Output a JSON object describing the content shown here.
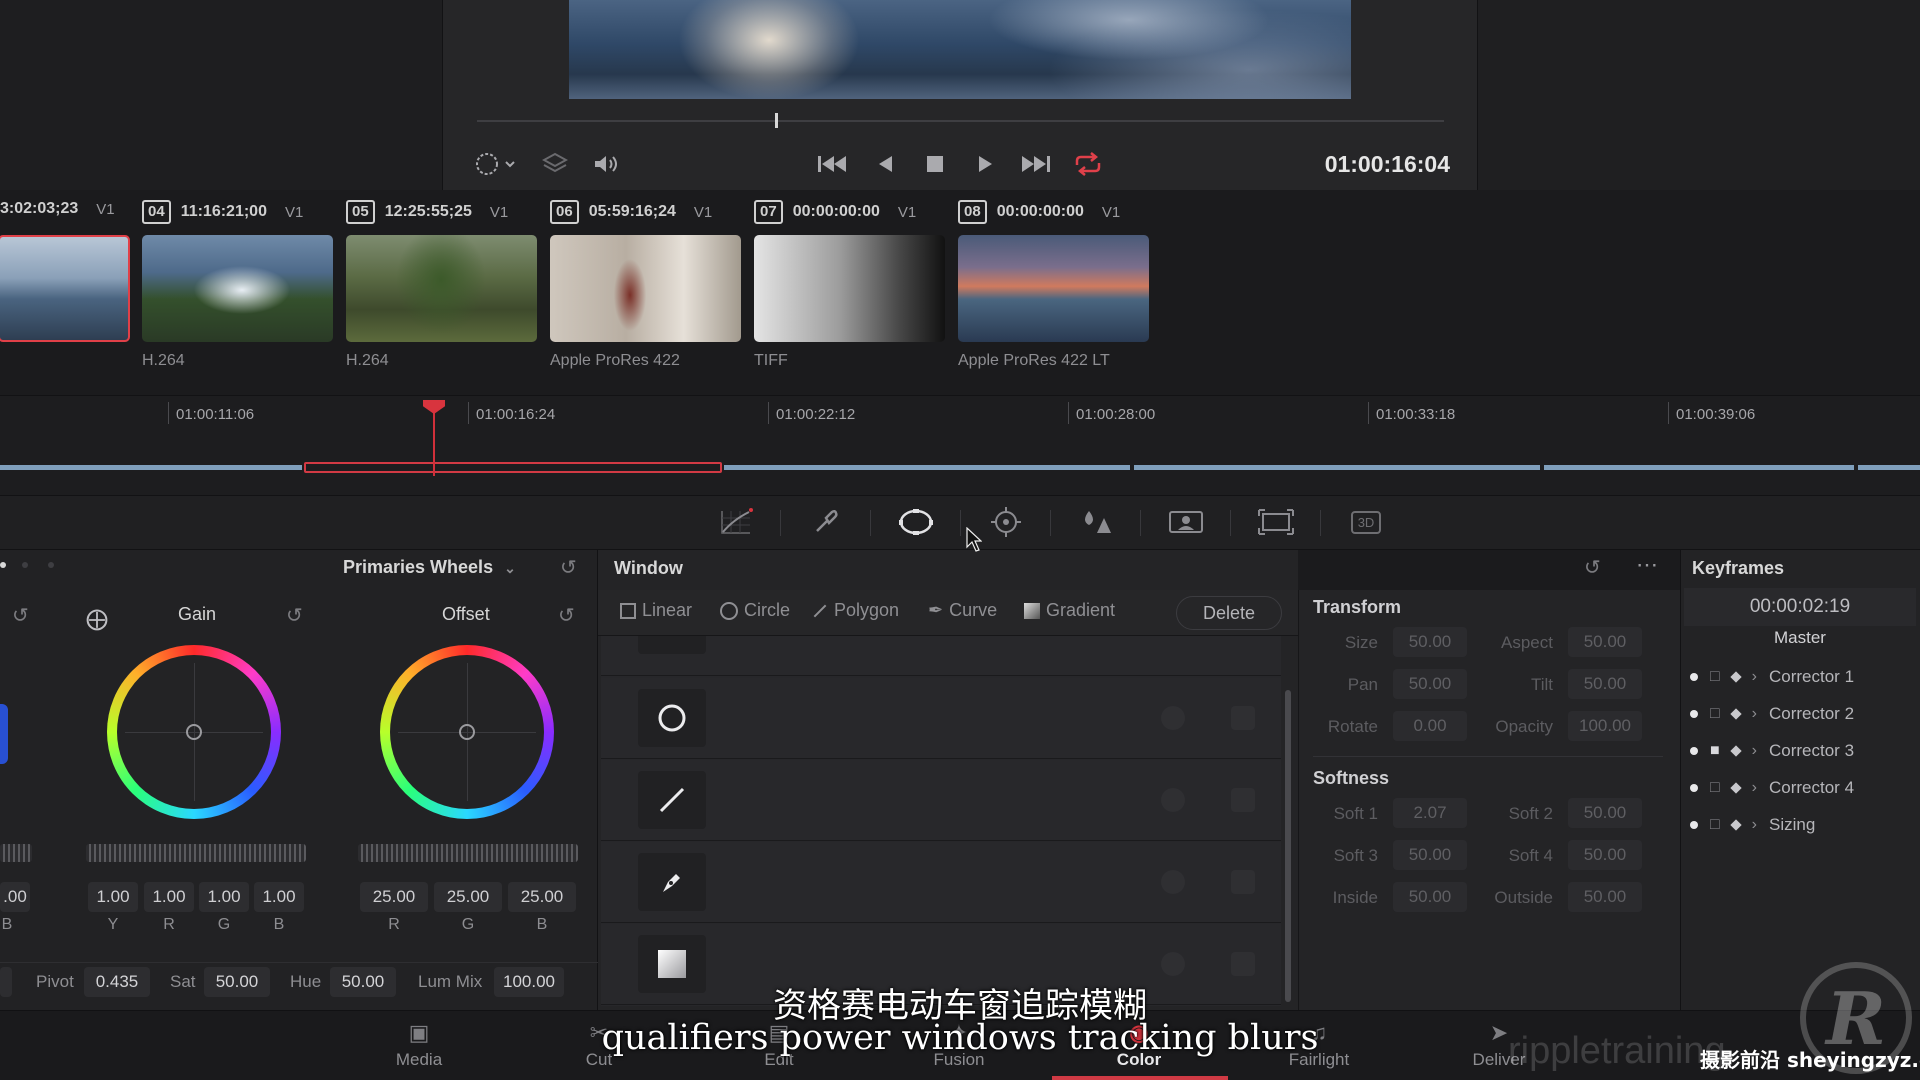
{
  "viewer": {
    "timecode": "01:00:16:04",
    "icons": [
      "target-icon",
      "layers-icon",
      "volume-icon",
      "skip-back-icon",
      "step-back-icon",
      "stop-icon",
      "play-icon",
      "skip-forward-icon",
      "loop-icon"
    ],
    "loop_color": "#e0404a"
  },
  "clips": [
    {
      "tc": "3:02:03;23",
      "track": "V1",
      "codec": ""
    },
    {
      "num": "04",
      "tc": "11:16:21;00",
      "track": "V1",
      "codec": "H.264"
    },
    {
      "num": "05",
      "tc": "12:25:55;25",
      "track": "V1",
      "codec": "H.264"
    },
    {
      "num": "06",
      "tc": "05:59:16;24",
      "track": "V1",
      "codec": "Apple ProRes 422"
    },
    {
      "num": "07",
      "tc": "00:00:00:00",
      "track": "V1",
      "codec": "TIFF"
    },
    {
      "num": "08",
      "tc": "00:00:00:00",
      "track": "V1",
      "codec": "Apple ProRes 422 LT"
    }
  ],
  "timeline": {
    "ticks": [
      "01:00:11:06",
      "01:00:16:24",
      "01:00:22:12",
      "01:00:28:00",
      "01:00:33:18",
      "01:00:39:06"
    ],
    "playhead_color": "#d8343e"
  },
  "palette": {
    "icons": [
      "curves-icon",
      "qualifier-eyedropper-icon",
      "power-window-icon",
      "tracker-icon",
      "blur-icon",
      "key-icon",
      "sizing-icon",
      "3d-icon"
    ],
    "active": "power-window-icon",
    "threed_label": "3D"
  },
  "primaries": {
    "title": "Primaries Wheels",
    "wheels": [
      {
        "name": "Gain",
        "values": [
          "1.00",
          "1.00",
          "1.00",
          "1.00"
        ],
        "labels": [
          "Y",
          "R",
          "G",
          "B"
        ]
      },
      {
        "name": "Offset",
        "values": [
          "25.00",
          "25.00",
          "25.00"
        ],
        "labels": [
          "R",
          "G",
          "B"
        ]
      }
    ],
    "partial_value": ".00",
    "partial_label": "B",
    "bottom": {
      "pivot_label": "Pivot",
      "pivot": "0.435",
      "sat_label": "Sat",
      "sat": "50.00",
      "hue_label": "Hue",
      "hue": "50.00",
      "lummix_label": "Lum Mix",
      "lummix": "100.00"
    }
  },
  "window": {
    "title": "Window",
    "shapes": [
      "Linear",
      "Circle",
      "Polygon",
      "Curve",
      "Gradient"
    ],
    "delete_label": "Delete",
    "rows": [
      "circle-window-icon",
      "linear-window-icon",
      "curve-pen-icon",
      "gradient-window-icon"
    ]
  },
  "transform": {
    "title": "Transform",
    "fields": [
      {
        "l1": "Size",
        "v1": "50.00",
        "l2": "Aspect",
        "v2": "50.00"
      },
      {
        "l1": "Pan",
        "v1": "50.00",
        "l2": "Tilt",
        "v2": "50.00"
      },
      {
        "l1": "Rotate",
        "v1": "0.00",
        "l2": "Opacity",
        "v2": "100.00"
      }
    ],
    "softness_title": "Softness",
    "softness": [
      {
        "l1": "Soft 1",
        "v1": "2.07",
        "l2": "Soft 2",
        "v2": "50.00"
      },
      {
        "l1": "Soft 3",
        "v1": "50.00",
        "l2": "Soft 4",
        "v2": "50.00"
      },
      {
        "l1": "Inside",
        "v1": "50.00",
        "l2": "Outside",
        "v2": "50.00"
      }
    ]
  },
  "keyframes": {
    "title": "Keyframes",
    "time": "00:00:02:19",
    "master": "Master",
    "rows": [
      "Corrector 1",
      "Corrector 2",
      "Corrector 3",
      "Corrector 4",
      "Sizing"
    ]
  },
  "nav": {
    "items": [
      "Media",
      "Cut",
      "Edit",
      "Fusion",
      "Color",
      "Fairlight",
      "Deliver"
    ],
    "active": "Color"
  },
  "overlay": {
    "subtitle_cn": "资格赛电动车窗追踪模糊",
    "subtitle_en": "qualifiers power windows tracking blurs",
    "watermark": "rippletraining",
    "watermark_cn": "摄影前沿 sheyingzyz.com",
    "logo_letter": "R"
  }
}
